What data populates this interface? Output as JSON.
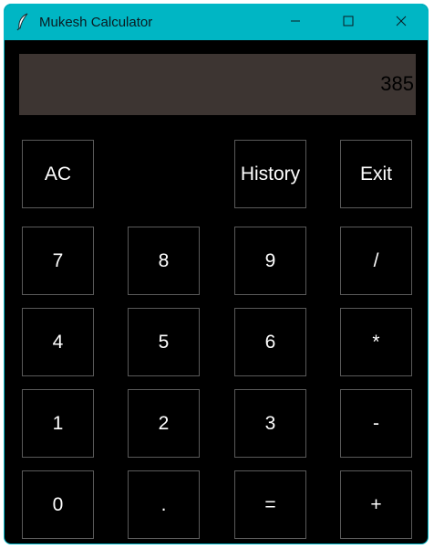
{
  "window": {
    "title": "Mukesh Calculator"
  },
  "display": {
    "value": "385"
  },
  "buttons": {
    "ac": "AC",
    "history": "History",
    "exit": "Exit",
    "seven": "7",
    "eight": "8",
    "nine": "9",
    "divide": "/",
    "four": "4",
    "five": "5",
    "six": "6",
    "multiply": "*",
    "one": "1",
    "two": "2",
    "three": "3",
    "subtract": "-",
    "zero": "0",
    "decimal": ".",
    "equals": "=",
    "add": "+"
  },
  "icons": {
    "app": "feather-icon",
    "minimize": "minimize-icon",
    "maximize": "maximize-icon",
    "close": "close-icon"
  },
  "colors": {
    "titlebar": "#00b6c4",
    "window_background": "#000000",
    "display_background": "#3d3532",
    "button_text": "#ffffff",
    "button_border": "#5a5a5a"
  }
}
